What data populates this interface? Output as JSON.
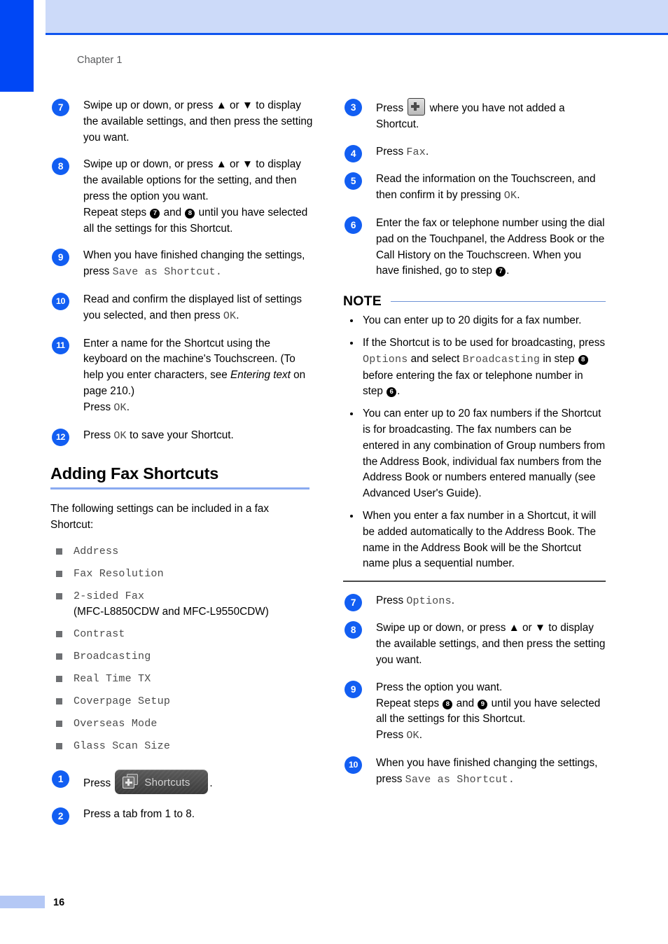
{
  "page": {
    "chapter_label": "Chapter 1",
    "page_number": "16",
    "accent_blue": "#0047f5",
    "header_band_color": "#ccdaf9",
    "step_marker_color": "#125ef2",
    "rule_color": "#8aaaf0"
  },
  "left_column": {
    "steps": [
      {
        "number": "7",
        "lines": [
          "Swipe up or down, or press ▲ or ▼ to display the available settings, and then press the setting you want."
        ]
      },
      {
        "number": "8",
        "text_before_repeat": "Swipe up or down, or press ▲ or ▼ to display the available options for the setting, and then press the option you want.",
        "repeat_prefix": "Repeat steps ",
        "repeat_ref_a": "7",
        "repeat_middle": " and ",
        "repeat_ref_b": "8",
        "repeat_suffix": " until you have selected all the settings for this Shortcut."
      },
      {
        "number": "9",
        "text_before": "When you have finished changing the settings, press ",
        "lcd": "Save as Shortcut.",
        "text_after": ""
      },
      {
        "number": "10",
        "text_before": "Read and confirm the displayed list of settings you selected, and then press ",
        "lcd": "OK",
        "text_after": "."
      },
      {
        "number": "11",
        "text_a": "Enter a name for the Shortcut using the keyboard on the machine's Touchscreen. (To help you enter characters, see ",
        "italic": "Entering text",
        "text_b": " on page 210.)",
        "press_label": "Press ",
        "lcd": "OK",
        "text_after": "."
      },
      {
        "number": "12",
        "text_before": "Press ",
        "lcd": "OK",
        "text_after": " to save your Shortcut."
      }
    ],
    "section": {
      "heading": "Adding Fax Shortcuts",
      "intro": "The following settings can be included in a fax Shortcut:",
      "settings": [
        {
          "lcd": "Address",
          "sub": ""
        },
        {
          "lcd": "Fax Resolution",
          "sub": ""
        },
        {
          "lcd": "2-sided Fax",
          "sub": "(MFC-L8850CDW and MFC-L9550CDW)"
        },
        {
          "lcd": "Contrast",
          "sub": ""
        },
        {
          "lcd": "Broadcasting",
          "sub": ""
        },
        {
          "lcd": "Real Time TX",
          "sub": ""
        },
        {
          "lcd": "Coverpage Setup",
          "sub": ""
        },
        {
          "lcd": "Overseas Mode",
          "sub": ""
        },
        {
          "lcd": "Glass Scan Size",
          "sub": ""
        }
      ]
    },
    "steps_after_section": [
      {
        "number": "1",
        "text_before": "Press ",
        "button_label": "Shortcuts",
        "text_after": "."
      },
      {
        "number": "2",
        "text": "Press a tab from 1 to 8."
      }
    ]
  },
  "right_column": {
    "steps": [
      {
        "number": "3",
        "text_before": "Press ",
        "icon": "plus-icon",
        "text_after": " where you have not added a Shortcut."
      },
      {
        "number": "4",
        "text_before": "Press ",
        "lcd": "Fax",
        "text_after": "."
      },
      {
        "number": "5",
        "text_before": "Read the information on the Touchscreen, and then confirm it by pressing ",
        "lcd": "OK",
        "text_after": "."
      },
      {
        "number": "6",
        "text_before": "Enter the fax or telephone number using the dial pad on the Touchpanel, the Address Book or the Call History on the Touchscreen. When you have finished, go to step ",
        "ref": "7",
        "text_after": "."
      }
    ],
    "note": {
      "title": "NOTE",
      "items": [
        {
          "parts": [
            {
              "type": "text",
              "value": "You can enter up to 20 digits for a fax number."
            }
          ]
        },
        {
          "parts": [
            {
              "type": "text",
              "value": "If the Shortcut is to be used for broadcasting, press "
            },
            {
              "type": "lcd",
              "value": "Options"
            },
            {
              "type": "text",
              "value": " and select "
            },
            {
              "type": "lcd",
              "value": "Broadcasting"
            },
            {
              "type": "text",
              "value": " in step "
            },
            {
              "type": "ref",
              "value": "8"
            },
            {
              "type": "text",
              "value": " before entering the fax or telephone number in step "
            },
            {
              "type": "ref",
              "value": "6"
            },
            {
              "type": "text",
              "value": "."
            }
          ]
        },
        {
          "parts": [
            {
              "type": "text",
              "value": "You can enter up to 20 fax numbers if the Shortcut is for broadcasting. The fax numbers can be entered in any combination of Group numbers from the Address Book, individual fax numbers from the Address Book or numbers entered manually (see Advanced User's Guide)."
            }
          ]
        },
        {
          "parts": [
            {
              "type": "text",
              "value": "When you enter a fax number in a Shortcut, it will be added automatically to the Address Book. The name in the Address Book will be the Shortcut name plus a sequential number."
            }
          ]
        }
      ]
    },
    "steps_after_note": [
      {
        "number": "7",
        "text_before": "Press ",
        "lcd": "Options",
        "text_after": "."
      },
      {
        "number": "8",
        "text": "Swipe up or down, or press ▲ or ▼ to display the available settings, and then press the setting you want."
      },
      {
        "number": "9",
        "line1": "Press the option you want.",
        "repeat_prefix": "Repeat steps ",
        "repeat_ref_a": "8",
        "repeat_middle": " and ",
        "repeat_ref_b": "9",
        "repeat_suffix": " until you have selected all the settings for this Shortcut.",
        "press_label": "Press ",
        "lcd": "OK",
        "press_after": "."
      },
      {
        "number": "10",
        "text_before": "When you have finished changing the settings, press ",
        "lcd": "Save as Shortcut.",
        "text_after": ""
      }
    ]
  }
}
